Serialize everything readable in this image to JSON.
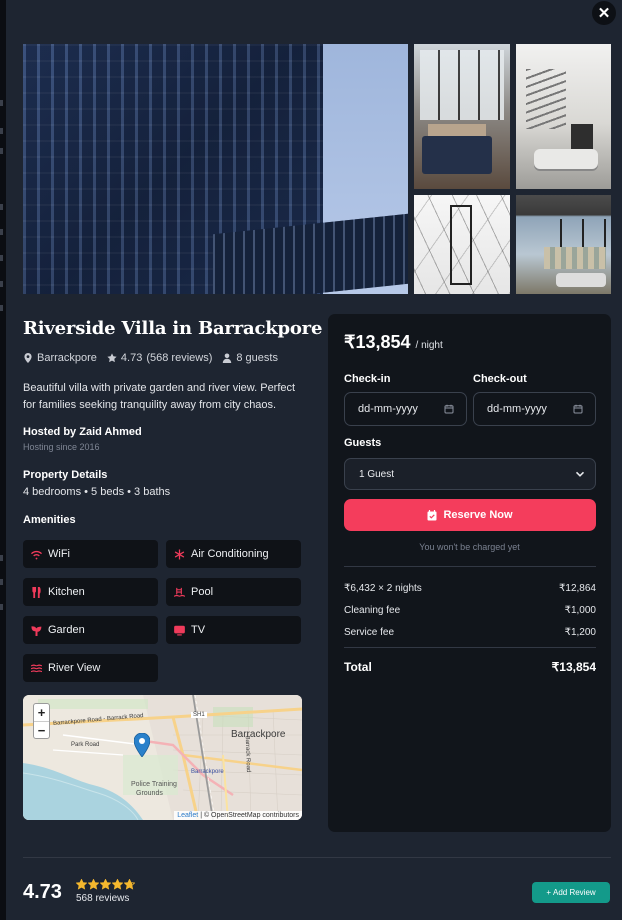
{
  "close_icon": "close-icon",
  "listing": {
    "title": "Riverside Villa in Barrackpore",
    "location": "Barrackpore",
    "rating": "4.73",
    "reviews_label": "(568 reviews)",
    "guests": "8 guests",
    "description": "Beautiful villa with private garden and river view. Perfect for families seeking tranquility away from city chaos.",
    "host": {
      "name": "Hosted by Zaid Ahmed",
      "since": "Hosting since 2016"
    },
    "property_details": {
      "label": "Property Details",
      "value": "4 bedrooms • 5 beds • 3 baths"
    },
    "amenities_label": "Amenities",
    "amenities": [
      {
        "label": "WiFi",
        "icon": "wifi-icon"
      },
      {
        "label": "Air Conditioning",
        "icon": "snowflake-icon"
      },
      {
        "label": "Kitchen",
        "icon": "utensils-icon"
      },
      {
        "label": "Pool",
        "icon": "pool-icon"
      },
      {
        "label": "Garden",
        "icon": "seedling-icon"
      },
      {
        "label": "TV",
        "icon": "tv-icon"
      },
      {
        "label": "River View",
        "icon": "water-icon"
      }
    ]
  },
  "map": {
    "zoom_in": "+",
    "zoom_out": "−",
    "labels": {
      "road1": "Barrackpore Road - Barrack Road",
      "sh1": "SH1",
      "town": "Barrackpore",
      "park": "Park Road",
      "barrackpore_small": "Barrackpore",
      "police": "Police Training",
      "grounds": "Grounds",
      "barrack_road": "Barrack Road"
    },
    "attribution_leaflet": "Leaflet",
    "attribution_rest": "| © OpenStreetMap contributors"
  },
  "booking": {
    "price": "₹13,854",
    "per_night": "/ night",
    "checkin_label": "Check-in",
    "checkout_label": "Check-out",
    "checkin_placeholder": "dd-mm-yyyy",
    "checkout_placeholder": "dd-mm-yyyy",
    "guests_label": "Guests",
    "guests_value": "1 Guest",
    "reserve_label": "Reserve Now",
    "no_charge": "You won't be charged yet",
    "lines": [
      {
        "label": "₹6,432 × 2 nights",
        "value": "₹12,864"
      },
      {
        "label": "Cleaning fee",
        "value": "₹1,000"
      },
      {
        "label": "Service fee",
        "value": "₹1,200"
      }
    ],
    "total_label": "Total",
    "total_value": "₹13,854"
  },
  "reviews": {
    "rating": "4.73",
    "count": "568 reviews",
    "stars": 4.73,
    "add_label": "Add Review",
    "star_color": "#f5b82e"
  },
  "colors": {
    "accent": "#f43d5c",
    "teal": "#139a8a"
  }
}
